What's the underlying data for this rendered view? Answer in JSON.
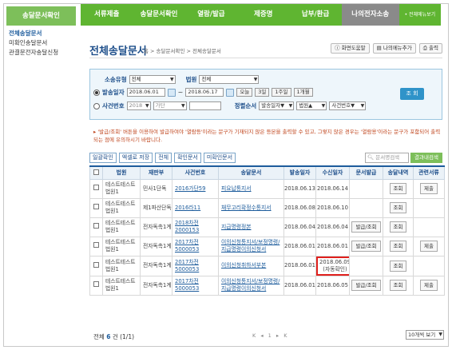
{
  "nav": {
    "items": [
      "서류제출",
      "송달문서확인",
      "열람/발급",
      "제증명",
      "납부/환급",
      "나의전자소송",
      "전체메뉴보기"
    ]
  },
  "sidebar": {
    "title": "송달문서확인",
    "items": [
      "전체송달문서",
      "미확인송달문서",
      "관결문전자송달신청"
    ]
  },
  "header": {
    "title": "전체송달문서",
    "breadcrumb": "홈 > 송달문서확인 > 전체송달문서",
    "tools": [
      "화면도움말",
      "나의메뉴추가",
      "출력"
    ]
  },
  "search": {
    "case_type_label": "소송유형",
    "case_type_value": "전체",
    "court_label": "법원",
    "court_value": "전체",
    "date_label": "발송일자",
    "date_from": "2018.06.01",
    "date_to": "2018.06.17",
    "quick": [
      "오늘",
      "3일",
      "1주일",
      "1개월"
    ],
    "case_no_label": "사건번호",
    "case_year": "2018",
    "case_kind": "가단",
    "sort_label": "정렬순서",
    "sort_options": [
      "발송일자▼",
      "법원▲",
      "사건번호▼"
    ],
    "query_button": "조 회"
  },
  "notice": "▸ '발급/조회' 버튼을 이용하여 발급하여야 '열람등'이라는 문구가 기재되지 않은 등본을 출력할 수 있고, 그렇지 않은 경우는 '열람용'이라는 문구가 포함되어 출력되는 점에 유의하시기 바랍니다.",
  "table_toolbar": {
    "buttons": [
      "일괄확인",
      "엑셀로 저장",
      "전체",
      "확인문서",
      "미확인문서"
    ],
    "search_placeholder": "문서명검색",
    "search_button": "결과내검색"
  },
  "table": {
    "headers": [
      "",
      "법원",
      "재판부",
      "사건번호",
      "송달문서",
      "발송일자",
      "수신일자",
      "문서발급",
      "송달내역",
      "관련서류"
    ],
    "rows": [
      {
        "court": "테스트테스트법원1",
        "div": "민사1단독",
        "case": "2016가단59",
        "doc": "피요납통지서",
        "sent": "2018.06.13",
        "recv": "2018.06.14",
        "issue": "",
        "history": "조회",
        "related": "제출"
      },
      {
        "court": "테스트테스트법원1",
        "div": "제1파산단독",
        "case": "2016라11",
        "doc": "채무고리확정수통지서",
        "sent": "2018.06.08",
        "recv": "2018.06.10",
        "issue": "",
        "history": "조회",
        "related": ""
      },
      {
        "court": "테스트테스트법원1",
        "div": "전자독촉1계",
        "case": "2018차전2000153",
        "doc": "지급명령정본",
        "sent": "2018.06.04",
        "recv": "2018.06.04",
        "issue": "발급/조회",
        "history": "조회",
        "related": ""
      },
      {
        "court": "테스트테스트법원1",
        "div": "전자독촉1계",
        "case": "2017차전5000053",
        "doc": "이의신청통지서/보정명령/지급명령이의신청서",
        "sent": "2018.06.01",
        "recv": "2018.06.01",
        "issue": "발급/조회",
        "history": "조회",
        "related": "제출"
      },
      {
        "court": "테스트테스트법원1",
        "div": "전자독촉1계",
        "case": "2017차전5000053",
        "doc": "이의신청취하서부본",
        "sent": "2018.06.01",
        "recv": "2018.06.09\n(자동확인)",
        "issue": "",
        "history": "조회",
        "related": ""
      },
      {
        "court": "테스트테스트법원1",
        "div": "전자독촉1계",
        "case": "2017차전5000053",
        "doc": "이의신청통지서/보정명령/지급명령이의신청서",
        "sent": "2018.06.01",
        "recv": "2018.06.05",
        "issue": "발급/조회",
        "history": "조회",
        "related": "제출"
      }
    ]
  },
  "footer": {
    "total_label": "전체",
    "total_count": "6",
    "total_unit": "건 (1/1)",
    "pager": "K ◂ 1 ▸ K",
    "per_page": "10개씩 보기"
  },
  "colors": {
    "nav_green": "#5fb531",
    "title_blue": "#1d4e8a",
    "highlight_red": "#e0201d"
  }
}
